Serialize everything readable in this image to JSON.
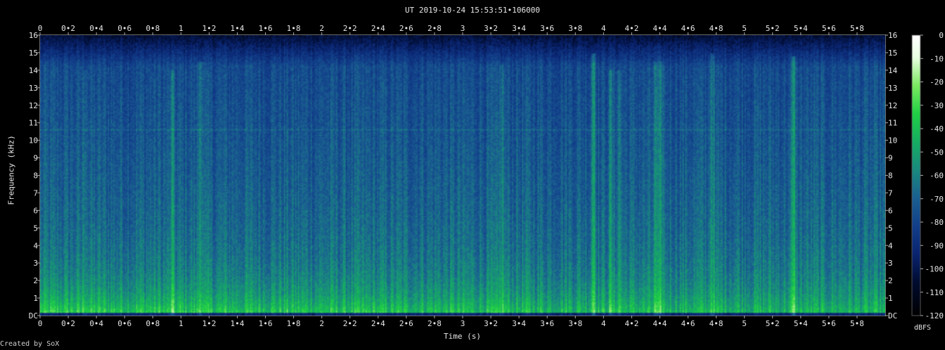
{
  "title": "UT 2019-10-24 15:53:51•106000",
  "footer": "Created by SoX",
  "chart_data": {
    "type": "heatmap",
    "xlabel": "Time (s)",
    "ylabel": "Frequency (kHz)",
    "colorbar_label": "dBFS",
    "xlim": [
      0,
      6
    ],
    "ylim": [
      0,
      16
    ],
    "zlim": [
      -120,
      0
    ],
    "x_ticks": [
      0,
      0.2,
      0.4,
      0.6,
      0.8,
      1,
      1.2,
      1.4,
      1.6,
      1.8,
      2,
      2.2,
      2.4,
      2.6,
      2.8,
      3,
      3.2,
      3.4,
      3.6,
      3.8,
      4,
      4.2,
      4.4,
      4.6,
      4.8,
      5,
      5.2,
      5.4,
      5.6,
      5.8
    ],
    "x_tick_labels": [
      "0",
      "0•2",
      "0•4",
      "0•6",
      "0•8",
      "1",
      "1•2",
      "1•4",
      "1•6",
      "1•8",
      "2",
      "2•2",
      "2•4",
      "2•6",
      "2•8",
      "3",
      "3•2",
      "3•4",
      "3•6",
      "3•8",
      "4",
      "4•2",
      "4•4",
      "4•6",
      "4•8",
      "5",
      "5•2",
      "5•4",
      "5•6",
      "5•8"
    ],
    "y_ticks": [
      0,
      1,
      2,
      3,
      4,
      5,
      6,
      7,
      8,
      9,
      10,
      11,
      12,
      13,
      14,
      15,
      16
    ],
    "y_tick_labels": [
      "DC",
      "1",
      "2",
      "3",
      "4",
      "5",
      "6",
      "7",
      "8",
      "9",
      "10",
      "11",
      "12",
      "13",
      "14",
      "15",
      "16"
    ],
    "colorbar_ticks": [
      0,
      -10,
      -20,
      -30,
      -40,
      -50,
      -60,
      -70,
      -80,
      -90,
      -100,
      -110,
      -120
    ],
    "colorbar_tick_labels": [
      "0",
      "-10",
      "-20",
      "-30",
      "-40",
      "-50",
      "-60",
      "-70",
      "-80",
      "-90",
      "-100",
      "-110",
      "-120"
    ],
    "colormap": [
      "#000000",
      "#000c30",
      "#0a2470",
      "#123f8a",
      "#1a6090",
      "#198a7e",
      "#16ad62",
      "#20d044",
      "#7ae860",
      "#e8ffe0",
      "#ffffff"
    ],
    "transients": [
      {
        "t": 0.32,
        "strength": 0.35,
        "top_khz": 14
      },
      {
        "t": 0.94,
        "strength": 0.5,
        "top_khz": 14
      },
      {
        "t": 1.14,
        "strength": 0.6,
        "top_khz": 14.5
      },
      {
        "t": 3.28,
        "strength": 0.45,
        "top_khz": 14.3
      },
      {
        "t": 3.93,
        "strength": 0.9,
        "top_khz": 15
      },
      {
        "t": 4.05,
        "strength": 0.45,
        "top_khz": 14
      },
      {
        "t": 4.11,
        "strength": 0.45,
        "top_khz": 14
      },
      {
        "t": 4.37,
        "strength": 0.5,
        "top_khz": 14.5
      },
      {
        "t": 4.41,
        "strength": 0.5,
        "top_khz": 14.5
      },
      {
        "t": 4.77,
        "strength": 0.6,
        "top_khz": 15
      },
      {
        "t": 5.35,
        "strength": 0.75,
        "top_khz": 14.8
      }
    ],
    "tonal_line_khz": 10.6
  }
}
